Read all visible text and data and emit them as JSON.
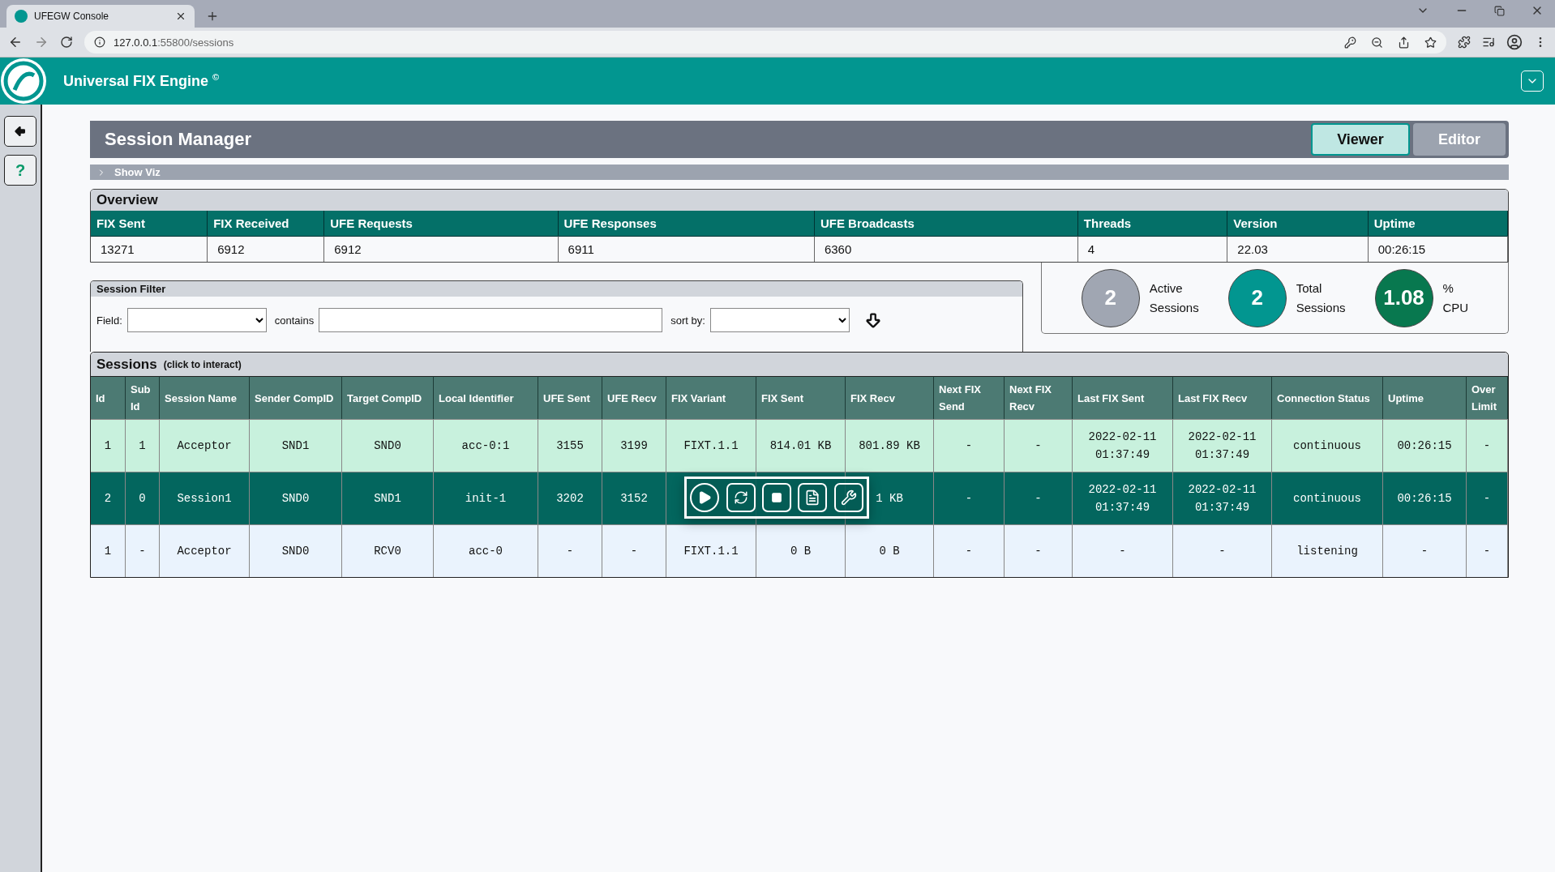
{
  "browser": {
    "tab_title": "UFEGW Console",
    "url_host": "127.0.0.1",
    "url_rest": ":55800/sessions"
  },
  "app": {
    "title": "Universal FIX Engine $^{©}$"
  },
  "sidebar": {
    "help_label": "?"
  },
  "page": {
    "title": "Session Manager",
    "modes": [
      {
        "label": "Viewer",
        "selected": true
      },
      {
        "label": "Editor",
        "selected": false
      }
    ],
    "show_viz": {
      "label": "Show Viz",
      "expanded": false
    }
  },
  "overview": {
    "title": "Overview",
    "columns": [
      "FIX Sent",
      "FIX Received",
      "UFE Requests",
      "UFE Responses",
      "UFE Broadcasts",
      "Threads",
      "Version",
      "Uptime"
    ],
    "values": [
      "13271",
      "6912",
      "6912",
      "6911",
      "6360",
      "4",
      "22.03",
      "00:26:15"
    ]
  },
  "filter": {
    "title": "Session Filter",
    "field_label": "Field:",
    "contains_label": "contains",
    "sort_label": "sort by:"
  },
  "stats": [
    {
      "value": "2",
      "label": "Active Sessions",
      "color": "#a0a6b2"
    },
    {
      "value": "2",
      "label": "Total Sessions",
      "color": "#029690"
    },
    {
      "value": "1.08",
      "label": "% CPU",
      "color": "#08784f"
    }
  ],
  "sessions": {
    "title": "Sessions",
    "hint": "(click to interact)",
    "columns": [
      "Id",
      "Sub Id",
      "Session Name",
      "Sender CompID",
      "Target CompID",
      "Local Identifier",
      "UFE Sent",
      "UFE Recv",
      "FIX Variant",
      "FIX Sent",
      "FIX Recv",
      "Next FIX Send",
      "Next FIX Recv",
      "Last FIX Sent",
      "Last FIX Recv",
      "Connection Status",
      "Uptime",
      "Over Limit"
    ],
    "rows": [
      {
        "selected": false,
        "color": "#c8f1dd",
        "cells": [
          "1",
          "1",
          "Acceptor",
          "SND1",
          "SND0",
          "acc-0:1",
          "3155",
          "3199",
          "FIXT.1.1",
          "814.01 KB",
          "801.89 KB",
          "-",
          "-",
          "2022-02-11 01:37:49",
          "2022-02-11 01:37:49",
          "continuous",
          "00:26:15",
          "-"
        ]
      },
      {
        "selected": true,
        "cells": [
          "2",
          "0",
          "Session1",
          "SND0",
          "SND1",
          "init-1",
          "3202",
          "3152",
          null,
          null,
          "1 KB",
          "-",
          "-",
          "2022-02-11 01:37:49",
          "2022-02-11 01:37:49",
          "continuous",
          "00:26:15",
          "-"
        ]
      },
      {
        "selected": false,
        "color": "#eaf3fd",
        "cells": [
          "1",
          "-",
          "Acceptor",
          "SND0",
          "RCV0",
          "acc-0",
          "-",
          "-",
          "FIXT.1.1",
          "0 B",
          "0 B",
          "-",
          "-",
          "-",
          "-",
          "listening",
          "-",
          "-"
        ]
      }
    ]
  }
}
